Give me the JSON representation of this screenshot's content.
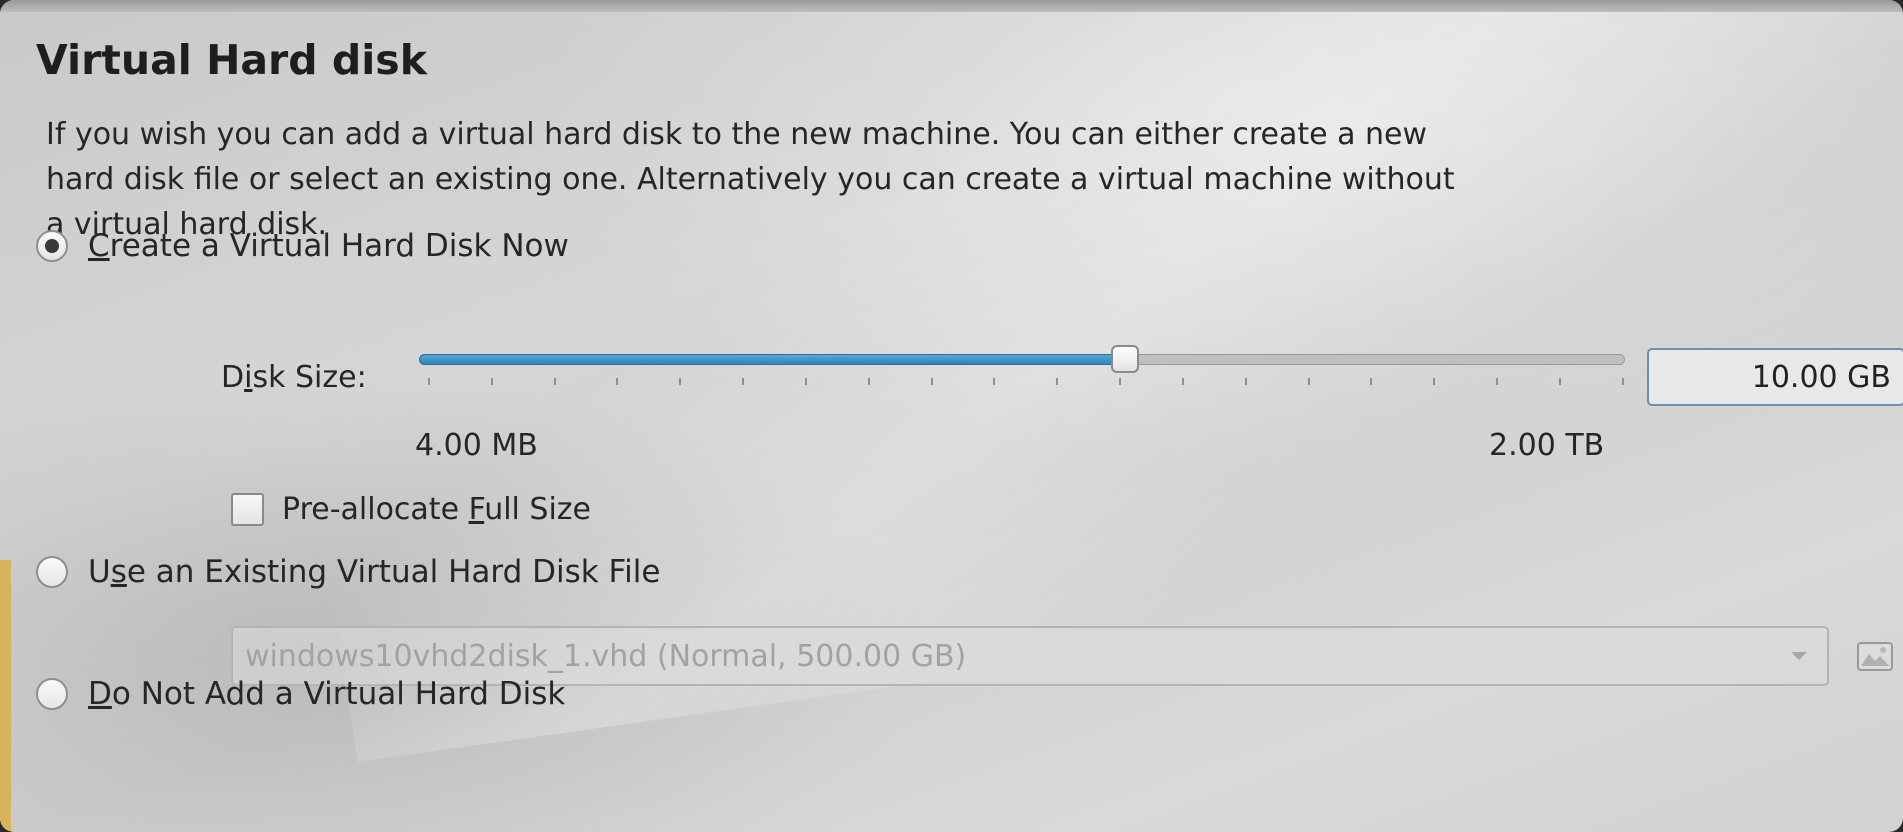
{
  "title": "Virtual Hard disk",
  "description": "If you wish you can add a virtual hard disk to the new machine. You can either create a new\nhard disk file or select an existing one. Alternatively you can create a virtual machine without\na virtual hard disk.",
  "options": {
    "create_now": {
      "mnemonic": "C",
      "label_rest": "reate a Virtual Hard Disk Now",
      "checked": true
    },
    "use_existing": {
      "label_pre": "U",
      "mnemonic": "s",
      "label_rest": "e an Existing Virtual Hard Disk File",
      "checked": false
    },
    "do_not_add": {
      "mnemonic": "D",
      "label_rest": "o Not Add a Virtual Hard Disk",
      "checked": false
    }
  },
  "disk_size": {
    "label_pre": "D",
    "mnemonic": "i",
    "label_rest": "sk Size:",
    "value": "10.00 GB",
    "slider_fraction": 0.585,
    "tick_count": 20,
    "min_label": "4.00 MB",
    "max_label": "2.00 TB"
  },
  "preallocate": {
    "label_pre": "Pre-allocate ",
    "mnemonic": "F",
    "label_rest": "ull Size",
    "checked": false
  },
  "existing_file": {
    "value": "windows10vhd2disk_1.vhd (Normal, 500.00 GB)",
    "enabled": false
  },
  "icons": {
    "folder_button": "folder-open-icon",
    "combo_arrow": "chevron-down-icon"
  },
  "colors": {
    "slider_fill": "#2f82be",
    "accent_stripe": "#d9b35a",
    "input_border": "#6a8fb0"
  }
}
